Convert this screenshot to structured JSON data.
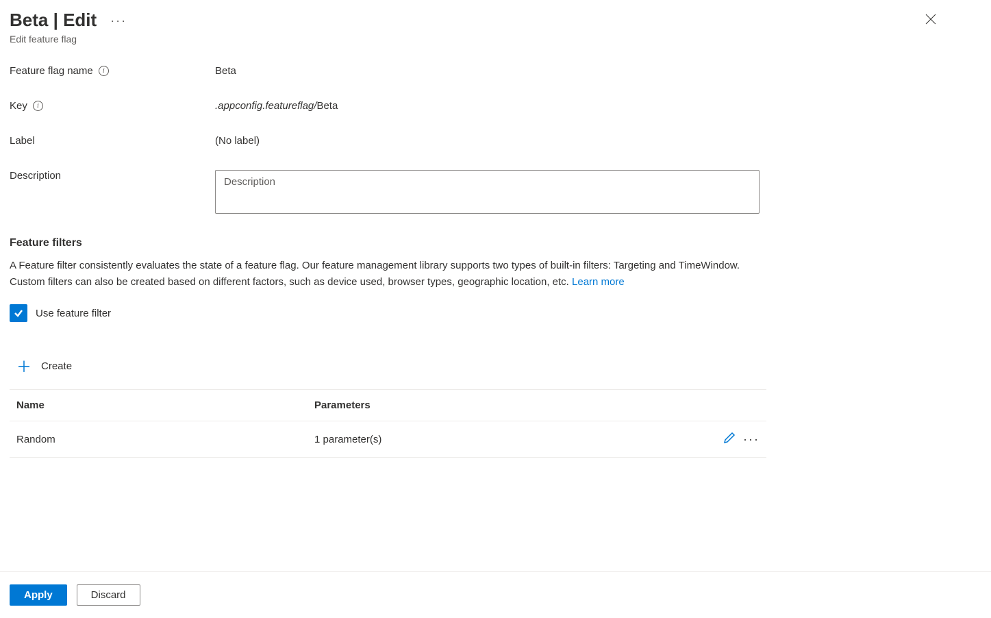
{
  "header": {
    "title": "Beta | Edit",
    "subtitle": "Edit feature flag",
    "more_label": "···"
  },
  "form": {
    "name_label": "Feature flag name",
    "name_value": "Beta",
    "key_label": "Key",
    "key_prefix": ".appconfig.featureflag/",
    "key_value": "Beta",
    "label_label": "Label",
    "label_value": "(No label)",
    "description_label": "Description",
    "description_placeholder": "Description"
  },
  "filters": {
    "section_title": "Feature filters",
    "section_desc": "A Feature filter consistently evaluates the state of a feature flag. Our feature management library supports two types of built-in filters: Targeting and TimeWindow. Custom filters can also be created based on different factors, such as device used, browser types, geographic location, etc. ",
    "learn_more": "Learn more",
    "checkbox_label": "Use feature filter",
    "checkbox_checked": true,
    "create_label": "Create",
    "table": {
      "col_name": "Name",
      "col_params": "Parameters",
      "rows": [
        {
          "name": "Random",
          "params": "1 parameter(s)"
        }
      ]
    }
  },
  "footer": {
    "apply": "Apply",
    "discard": "Discard"
  }
}
